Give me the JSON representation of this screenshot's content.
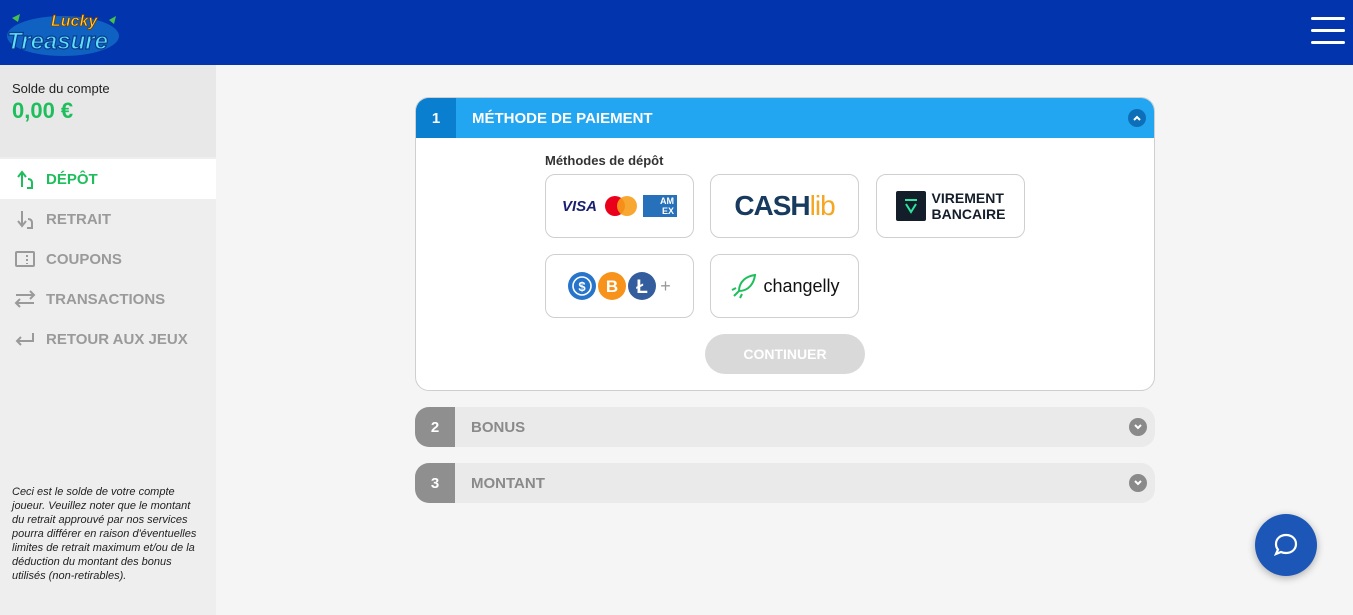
{
  "header": {
    "logo_line1": "Lucky",
    "logo_line2": "Treasure",
    "menu_icon": "hamburger-icon"
  },
  "sidebar": {
    "balance_label": "Solde du compte",
    "balance_value": "0,00 €",
    "items": [
      {
        "label": "DÉPÔT",
        "icon": "deposit-icon",
        "active": true
      },
      {
        "label": "RETRAIT",
        "icon": "withdraw-icon",
        "active": false
      },
      {
        "label": "COUPONS",
        "icon": "coupon-icon",
        "active": false
      },
      {
        "label": "TRANSACTIONS",
        "icon": "transfer-arrows-icon",
        "active": false
      },
      {
        "label": "RETOUR AUX JEUX",
        "icon": "return-arrow-icon",
        "active": false
      }
    ],
    "note": "Ceci est le solde de votre compte joueur. Veuillez noter que le montant du retrait approuvé par nos services pourra différer en raison d'éventuelles limites de retrait maximum et/ou de la déduction du montant des bonus utilisés (non-retirables)."
  },
  "steps": [
    {
      "number": "1",
      "title": "MÉTHODE DE PAIEMENT",
      "expanded": true
    },
    {
      "number": "2",
      "title": "BONUS",
      "expanded": false
    },
    {
      "number": "3",
      "title": "MONTANT",
      "expanded": false
    }
  ],
  "payment": {
    "methods_label": "Méthodes de dépôt",
    "cards": {
      "visa": "VISA",
      "amex_line1": "AM",
      "amex_line2": "EX"
    },
    "cashlib": {
      "part1": "CASH",
      "part2": "lib"
    },
    "virement": {
      "line1": "VIREMENT",
      "line2": "BANCAIRE"
    },
    "crypto_more": "+",
    "changelly": "changelly",
    "continue_label": "CONTINUER"
  },
  "colors": {
    "header": "#0234ad",
    "accent_green": "#1fbe5c",
    "step_active": "#22a6f2",
    "chat": "#1c57b8"
  }
}
